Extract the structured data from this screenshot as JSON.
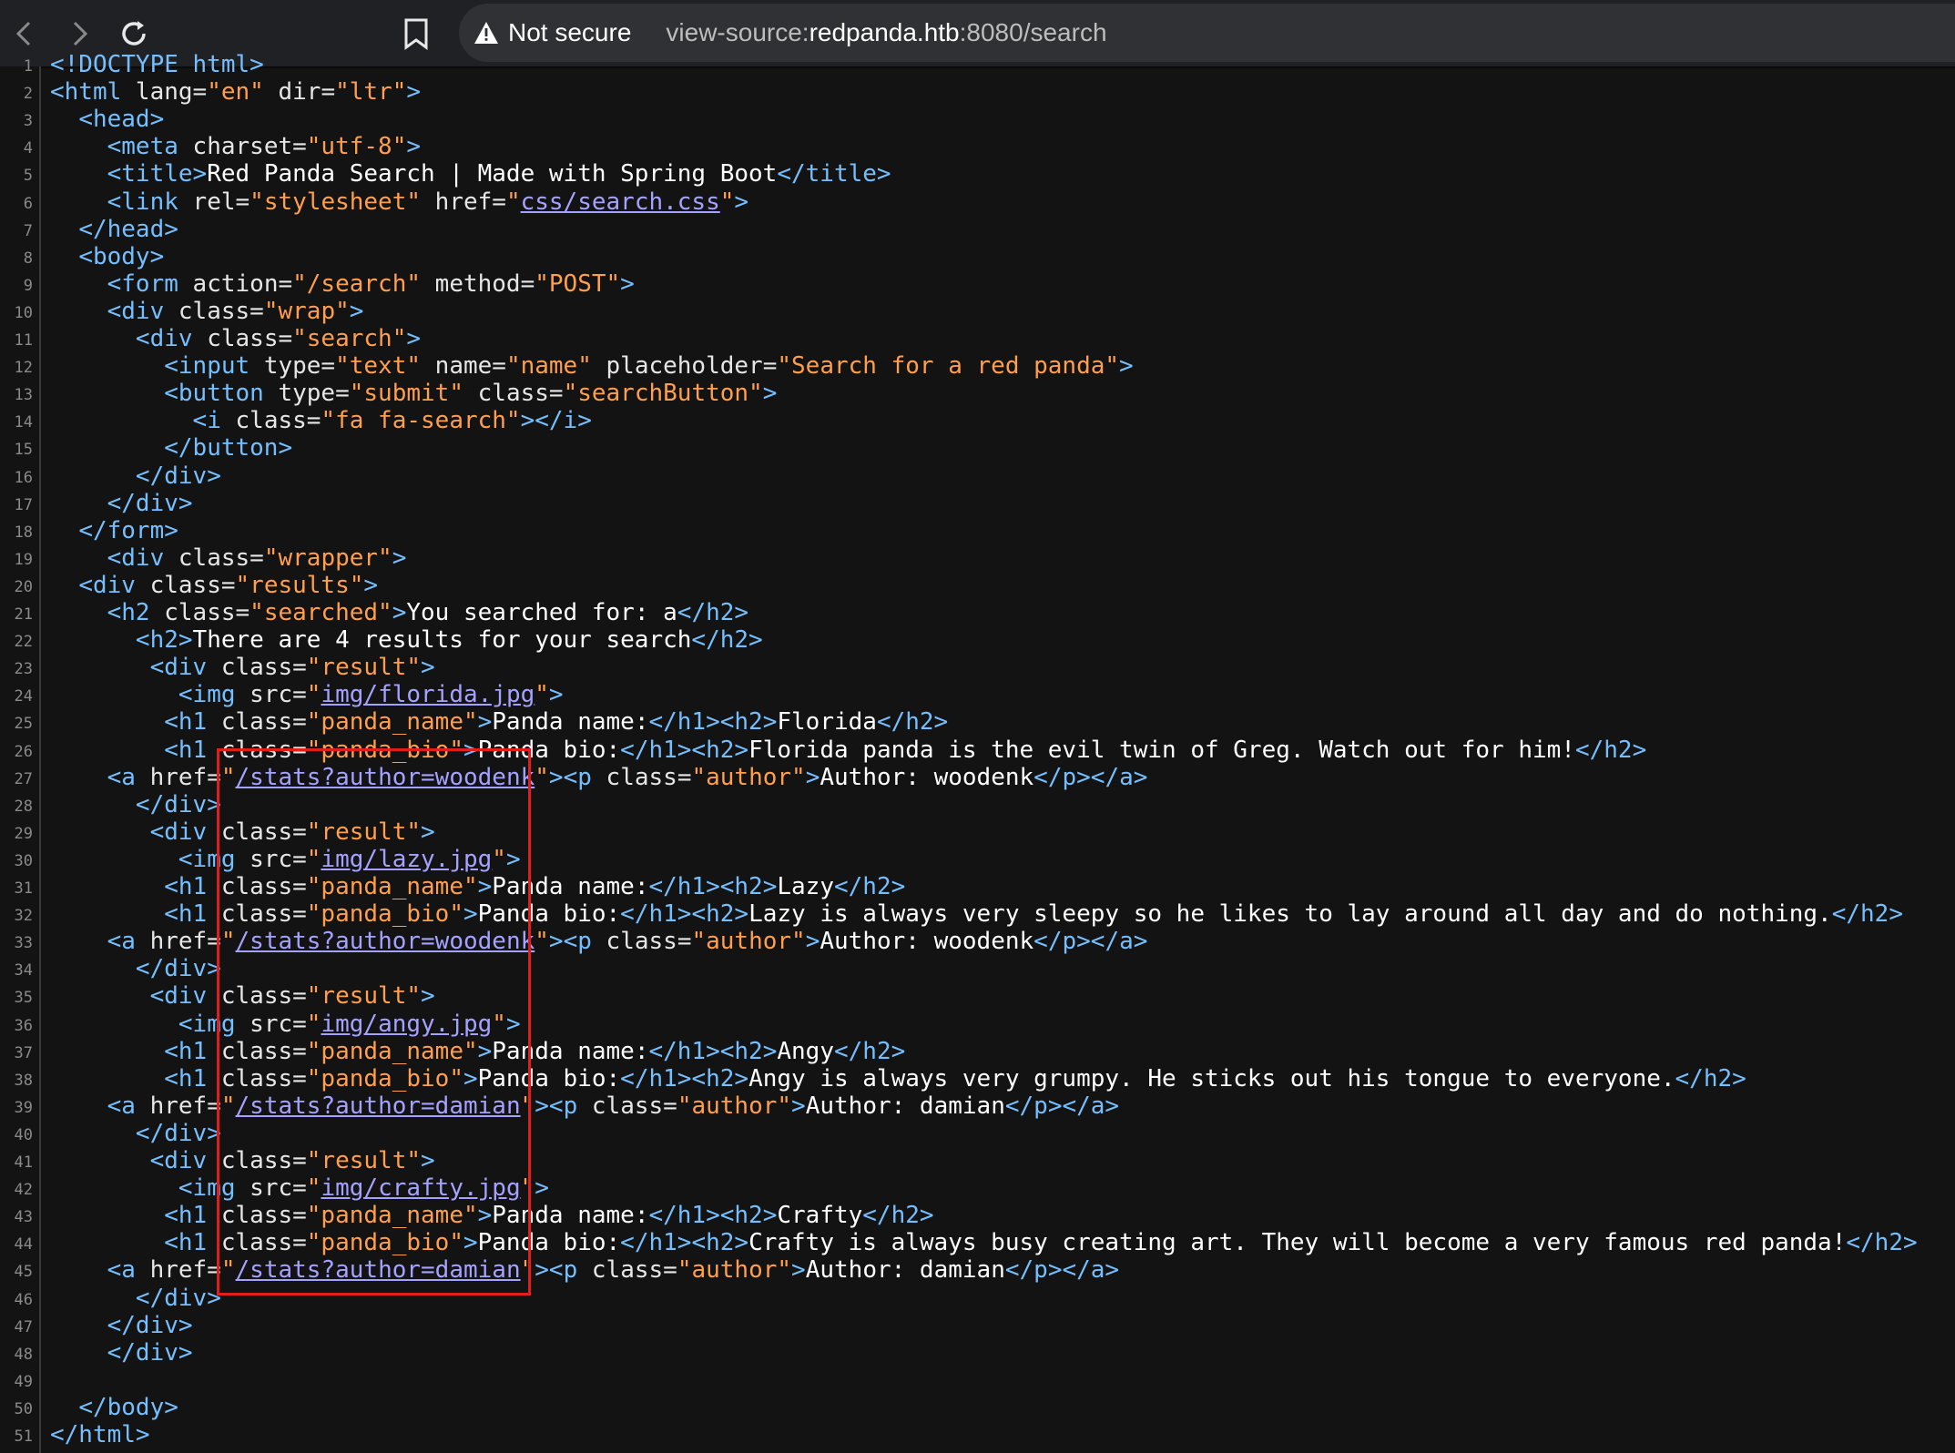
{
  "browser": {
    "security_label": "Not secure",
    "url_scheme": "view-source:",
    "url_host": "redpanda.htb",
    "url_rest": ":8080/search",
    "icons": [
      "back-arrow-icon",
      "forward-arrow-icon",
      "reload-icon",
      "bookmark-icon",
      "warning-icon"
    ]
  },
  "source_lines": [
    {
      "n": "1",
      "s": [
        [
          "t",
          "<!DOCTYPE html>"
        ]
      ]
    },
    {
      "n": "2",
      "s": [
        [
          "t",
          "<html "
        ],
        [
          "a",
          "lang="
        ],
        [
          "v",
          "\"en\""
        ],
        [
          "a",
          " dir="
        ],
        [
          "v",
          "\"ltr\""
        ],
        [
          "t",
          ">"
        ]
      ]
    },
    {
      "n": "3",
      "s": [
        [
          "x",
          "  "
        ],
        [
          "t",
          "<head>"
        ]
      ]
    },
    {
      "n": "4",
      "s": [
        [
          "x",
          "    "
        ],
        [
          "t",
          "<meta "
        ],
        [
          "a",
          "charset="
        ],
        [
          "v",
          "\"utf-8\""
        ],
        [
          "t",
          ">"
        ]
      ]
    },
    {
      "n": "5",
      "s": [
        [
          "x",
          "    "
        ],
        [
          "t",
          "<title>"
        ],
        [
          "x",
          "Red Panda Search | Made with Spring Boot"
        ],
        [
          "t",
          "</title>"
        ]
      ]
    },
    {
      "n": "6",
      "s": [
        [
          "x",
          "    "
        ],
        [
          "t",
          "<link "
        ],
        [
          "a",
          "rel="
        ],
        [
          "v",
          "\"stylesheet\""
        ],
        [
          "a",
          " href="
        ],
        [
          "v",
          "\""
        ],
        [
          "l",
          "css/search.css"
        ],
        [
          "v",
          "\""
        ],
        [
          "t",
          ">"
        ]
      ]
    },
    {
      "n": "7",
      "s": [
        [
          "x",
          "  "
        ],
        [
          "t",
          "</head>"
        ]
      ]
    },
    {
      "n": "8",
      "s": [
        [
          "x",
          "  "
        ],
        [
          "t",
          "<body>"
        ]
      ]
    },
    {
      "n": "9",
      "s": [
        [
          "x",
          "    "
        ],
        [
          "t",
          "<form "
        ],
        [
          "a",
          "action="
        ],
        [
          "v",
          "\"/search\""
        ],
        [
          "a",
          " method="
        ],
        [
          "v",
          "\"POST\""
        ],
        [
          "t",
          ">"
        ]
      ]
    },
    {
      "n": "10",
      "s": [
        [
          "x",
          "    "
        ],
        [
          "t",
          "<div "
        ],
        [
          "a",
          "class="
        ],
        [
          "v",
          "\"wrap\""
        ],
        [
          "t",
          ">"
        ]
      ]
    },
    {
      "n": "11",
      "s": [
        [
          "x",
          "      "
        ],
        [
          "t",
          "<div "
        ],
        [
          "a",
          "class="
        ],
        [
          "v",
          "\"search\""
        ],
        [
          "t",
          ">"
        ]
      ]
    },
    {
      "n": "12",
      "s": [
        [
          "x",
          "        "
        ],
        [
          "t",
          "<input "
        ],
        [
          "a",
          "type="
        ],
        [
          "v",
          "\"text\""
        ],
        [
          "a",
          " name="
        ],
        [
          "v",
          "\"name\""
        ],
        [
          "a",
          " placeholder="
        ],
        [
          "v",
          "\"Search for a red panda\""
        ],
        [
          "t",
          ">"
        ]
      ]
    },
    {
      "n": "13",
      "s": [
        [
          "x",
          "        "
        ],
        [
          "t",
          "<button "
        ],
        [
          "a",
          "type="
        ],
        [
          "v",
          "\"submit\""
        ],
        [
          "a",
          " class="
        ],
        [
          "v",
          "\"searchButton\""
        ],
        [
          "t",
          ">"
        ]
      ]
    },
    {
      "n": "14",
      "s": [
        [
          "x",
          "          "
        ],
        [
          "t",
          "<i "
        ],
        [
          "a",
          "class="
        ],
        [
          "v",
          "\"fa fa-search\""
        ],
        [
          "t",
          "></i>"
        ]
      ]
    },
    {
      "n": "15",
      "s": [
        [
          "x",
          "        "
        ],
        [
          "t",
          "</button>"
        ]
      ]
    },
    {
      "n": "16",
      "s": [
        [
          "x",
          "      "
        ],
        [
          "t",
          "</div>"
        ]
      ]
    },
    {
      "n": "17",
      "s": [
        [
          "x",
          "    "
        ],
        [
          "t",
          "</div>"
        ]
      ]
    },
    {
      "n": "18",
      "s": [
        [
          "x",
          "  "
        ],
        [
          "t",
          "</form>"
        ]
      ]
    },
    {
      "n": "19",
      "s": [
        [
          "x",
          "    "
        ],
        [
          "t",
          "<div "
        ],
        [
          "a",
          "class="
        ],
        [
          "v",
          "\"wrapper\""
        ],
        [
          "t",
          ">"
        ]
      ]
    },
    {
      "n": "20",
      "s": [
        [
          "x",
          "  "
        ],
        [
          "t",
          "<div "
        ],
        [
          "a",
          "class="
        ],
        [
          "v",
          "\"results\""
        ],
        [
          "t",
          ">"
        ]
      ]
    },
    {
      "n": "21",
      "s": [
        [
          "x",
          "    "
        ],
        [
          "t",
          "<h2 "
        ],
        [
          "a",
          "class="
        ],
        [
          "v",
          "\"searched\""
        ],
        [
          "t",
          ">"
        ],
        [
          "x",
          "You searched for: a"
        ],
        [
          "t",
          "</h2>"
        ]
      ]
    },
    {
      "n": "22",
      "s": [
        [
          "x",
          "      "
        ],
        [
          "t",
          "<h2>"
        ],
        [
          "x",
          "There are 4 results for your search"
        ],
        [
          "t",
          "</h2>"
        ]
      ]
    },
    {
      "n": "23",
      "s": [
        [
          "x",
          "       "
        ],
        [
          "t",
          "<div "
        ],
        [
          "a",
          "class="
        ],
        [
          "v",
          "\"result\""
        ],
        [
          "t",
          ">"
        ]
      ]
    },
    {
      "n": "24",
      "s": [
        [
          "x",
          "         "
        ],
        [
          "t",
          "<img "
        ],
        [
          "a",
          "src="
        ],
        [
          "v",
          "\""
        ],
        [
          "l",
          "img/florida.jpg"
        ],
        [
          "v",
          "\""
        ],
        [
          "t",
          ">"
        ]
      ]
    },
    {
      "n": "25",
      "s": [
        [
          "x",
          "        "
        ],
        [
          "t",
          "<h1 "
        ],
        [
          "a",
          "class="
        ],
        [
          "v",
          "\"panda_name\""
        ],
        [
          "t",
          ">"
        ],
        [
          "x",
          "Panda name:"
        ],
        [
          "t",
          "</h1><h2>"
        ],
        [
          "x",
          "Florida"
        ],
        [
          "t",
          "</h2>"
        ]
      ]
    },
    {
      "n": "26",
      "s": [
        [
          "x",
          "        "
        ],
        [
          "t",
          "<h1 "
        ],
        [
          "a",
          "class="
        ],
        [
          "v",
          "\"panda_bio\""
        ],
        [
          "t",
          ">"
        ],
        [
          "x",
          "Panda bio:"
        ],
        [
          "t",
          "</h1><h2>"
        ],
        [
          "x",
          "Florida panda is the evil twin of Greg. Watch out for him!"
        ],
        [
          "t",
          "</h2>"
        ]
      ]
    },
    {
      "n": "27",
      "s": [
        [
          "x",
          "    "
        ],
        [
          "t",
          "<a "
        ],
        [
          "a",
          "href="
        ],
        [
          "v",
          "\""
        ],
        [
          "l",
          "/stats?author=woodenk"
        ],
        [
          "v",
          "\""
        ],
        [
          "t",
          "><p "
        ],
        [
          "a",
          "class="
        ],
        [
          "v",
          "\"author\""
        ],
        [
          "t",
          ">"
        ],
        [
          "x",
          "Author: woodenk"
        ],
        [
          "t",
          "</p></a>"
        ]
      ]
    },
    {
      "n": "28",
      "s": [
        [
          "x",
          "      "
        ],
        [
          "t",
          "</div>"
        ]
      ]
    },
    {
      "n": "29",
      "s": [
        [
          "x",
          "       "
        ],
        [
          "t",
          "<div "
        ],
        [
          "a",
          "class="
        ],
        [
          "v",
          "\"result\""
        ],
        [
          "t",
          ">"
        ]
      ]
    },
    {
      "n": "30",
      "s": [
        [
          "x",
          "         "
        ],
        [
          "t",
          "<img "
        ],
        [
          "a",
          "src="
        ],
        [
          "v",
          "\""
        ],
        [
          "l",
          "img/lazy.jpg"
        ],
        [
          "v",
          "\""
        ],
        [
          "t",
          ">"
        ]
      ]
    },
    {
      "n": "31",
      "s": [
        [
          "x",
          "        "
        ],
        [
          "t",
          "<h1 "
        ],
        [
          "a",
          "class="
        ],
        [
          "v",
          "\"panda_name\""
        ],
        [
          "t",
          ">"
        ],
        [
          "x",
          "Panda name:"
        ],
        [
          "t",
          "</h1><h2>"
        ],
        [
          "x",
          "Lazy"
        ],
        [
          "t",
          "</h2>"
        ]
      ]
    },
    {
      "n": "32",
      "s": [
        [
          "x",
          "        "
        ],
        [
          "t",
          "<h1 "
        ],
        [
          "a",
          "class="
        ],
        [
          "v",
          "\"panda_bio\""
        ],
        [
          "t",
          ">"
        ],
        [
          "x",
          "Panda bio:"
        ],
        [
          "t",
          "</h1><h2>"
        ],
        [
          "x",
          "Lazy is always very sleepy so he likes to lay around all day and do nothing."
        ],
        [
          "t",
          "</h2>"
        ]
      ]
    },
    {
      "n": "33",
      "s": [
        [
          "x",
          "    "
        ],
        [
          "t",
          "<a "
        ],
        [
          "a",
          "href="
        ],
        [
          "v",
          "\""
        ],
        [
          "l",
          "/stats?author=woodenk"
        ],
        [
          "v",
          "\""
        ],
        [
          "t",
          "><p "
        ],
        [
          "a",
          "class="
        ],
        [
          "v",
          "\"author\""
        ],
        [
          "t",
          ">"
        ],
        [
          "x",
          "Author: woodenk"
        ],
        [
          "t",
          "</p></a>"
        ]
      ]
    },
    {
      "n": "34",
      "s": [
        [
          "x",
          "      "
        ],
        [
          "t",
          "</div>"
        ]
      ]
    },
    {
      "n": "35",
      "s": [
        [
          "x",
          "       "
        ],
        [
          "t",
          "<div "
        ],
        [
          "a",
          "class="
        ],
        [
          "v",
          "\"result\""
        ],
        [
          "t",
          ">"
        ]
      ]
    },
    {
      "n": "36",
      "s": [
        [
          "x",
          "         "
        ],
        [
          "t",
          "<img "
        ],
        [
          "a",
          "src="
        ],
        [
          "v",
          "\""
        ],
        [
          "l",
          "img/angy.jpg"
        ],
        [
          "v",
          "\""
        ],
        [
          "t",
          ">"
        ]
      ]
    },
    {
      "n": "37",
      "s": [
        [
          "x",
          "        "
        ],
        [
          "t",
          "<h1 "
        ],
        [
          "a",
          "class="
        ],
        [
          "v",
          "\"panda_name\""
        ],
        [
          "t",
          ">"
        ],
        [
          "x",
          "Panda name:"
        ],
        [
          "t",
          "</h1><h2>"
        ],
        [
          "x",
          "Angy"
        ],
        [
          "t",
          "</h2>"
        ]
      ]
    },
    {
      "n": "38",
      "s": [
        [
          "x",
          "        "
        ],
        [
          "t",
          "<h1 "
        ],
        [
          "a",
          "class="
        ],
        [
          "v",
          "\"panda_bio\""
        ],
        [
          "t",
          ">"
        ],
        [
          "x",
          "Panda bio:"
        ],
        [
          "t",
          "</h1><h2>"
        ],
        [
          "x",
          "Angy is always very grumpy. He sticks out his tongue to everyone."
        ],
        [
          "t",
          "</h2>"
        ]
      ]
    },
    {
      "n": "39",
      "s": [
        [
          "x",
          "    "
        ],
        [
          "t",
          "<a "
        ],
        [
          "a",
          "href="
        ],
        [
          "v",
          "\""
        ],
        [
          "l",
          "/stats?author=damian"
        ],
        [
          "v",
          "\""
        ],
        [
          "t",
          "><p "
        ],
        [
          "a",
          "class="
        ],
        [
          "v",
          "\"author\""
        ],
        [
          "t",
          ">"
        ],
        [
          "x",
          "Author: damian"
        ],
        [
          "t",
          "</p></a>"
        ]
      ]
    },
    {
      "n": "40",
      "s": [
        [
          "x",
          "      "
        ],
        [
          "t",
          "</div>"
        ]
      ]
    },
    {
      "n": "41",
      "s": [
        [
          "x",
          "       "
        ],
        [
          "t",
          "<div "
        ],
        [
          "a",
          "class="
        ],
        [
          "v",
          "\"result\""
        ],
        [
          "t",
          ">"
        ]
      ]
    },
    {
      "n": "42",
      "s": [
        [
          "x",
          "         "
        ],
        [
          "t",
          "<img "
        ],
        [
          "a",
          "src="
        ],
        [
          "v",
          "\""
        ],
        [
          "l",
          "img/crafty.jpg"
        ],
        [
          "v",
          "\""
        ],
        [
          "t",
          ">"
        ]
      ]
    },
    {
      "n": "43",
      "s": [
        [
          "x",
          "        "
        ],
        [
          "t",
          "<h1 "
        ],
        [
          "a",
          "class="
        ],
        [
          "v",
          "\"panda_name\""
        ],
        [
          "t",
          ">"
        ],
        [
          "x",
          "Panda name:"
        ],
        [
          "t",
          "</h1><h2>"
        ],
        [
          "x",
          "Crafty"
        ],
        [
          "t",
          "</h2>"
        ]
      ]
    },
    {
      "n": "44",
      "s": [
        [
          "x",
          "        "
        ],
        [
          "t",
          "<h1 "
        ],
        [
          "a",
          "class="
        ],
        [
          "v",
          "\"panda_bio\""
        ],
        [
          "t",
          ">"
        ],
        [
          "x",
          "Panda bio:"
        ],
        [
          "t",
          "</h1><h2>"
        ],
        [
          "x",
          "Crafty is always busy creating art. They will become a very famous red panda!"
        ],
        [
          "t",
          "</h2>"
        ]
      ]
    },
    {
      "n": "45",
      "s": [
        [
          "x",
          "    "
        ],
        [
          "t",
          "<a "
        ],
        [
          "a",
          "href="
        ],
        [
          "v",
          "\""
        ],
        [
          "l",
          "/stats?author=damian"
        ],
        [
          "v",
          "\""
        ],
        [
          "t",
          "><p "
        ],
        [
          "a",
          "class="
        ],
        [
          "v",
          "\"author\""
        ],
        [
          "t",
          ">"
        ],
        [
          "x",
          "Author: damian"
        ],
        [
          "t",
          "</p></a>"
        ]
      ]
    },
    {
      "n": "46",
      "s": [
        [
          "x",
          "      "
        ],
        [
          "t",
          "</div>"
        ]
      ]
    },
    {
      "n": "47",
      "s": [
        [
          "x",
          "    "
        ],
        [
          "t",
          "</div>"
        ]
      ]
    },
    {
      "n": "48",
      "s": [
        [
          "x",
          "    "
        ],
        [
          "t",
          "</div>"
        ]
      ]
    },
    {
      "n": "49",
      "s": []
    },
    {
      "n": "50",
      "s": [
        [
          "x",
          "  "
        ],
        [
          "t",
          "</body>"
        ]
      ]
    },
    {
      "n": "51",
      "s": [
        [
          "t",
          "</html>"
        ]
      ]
    }
  ]
}
